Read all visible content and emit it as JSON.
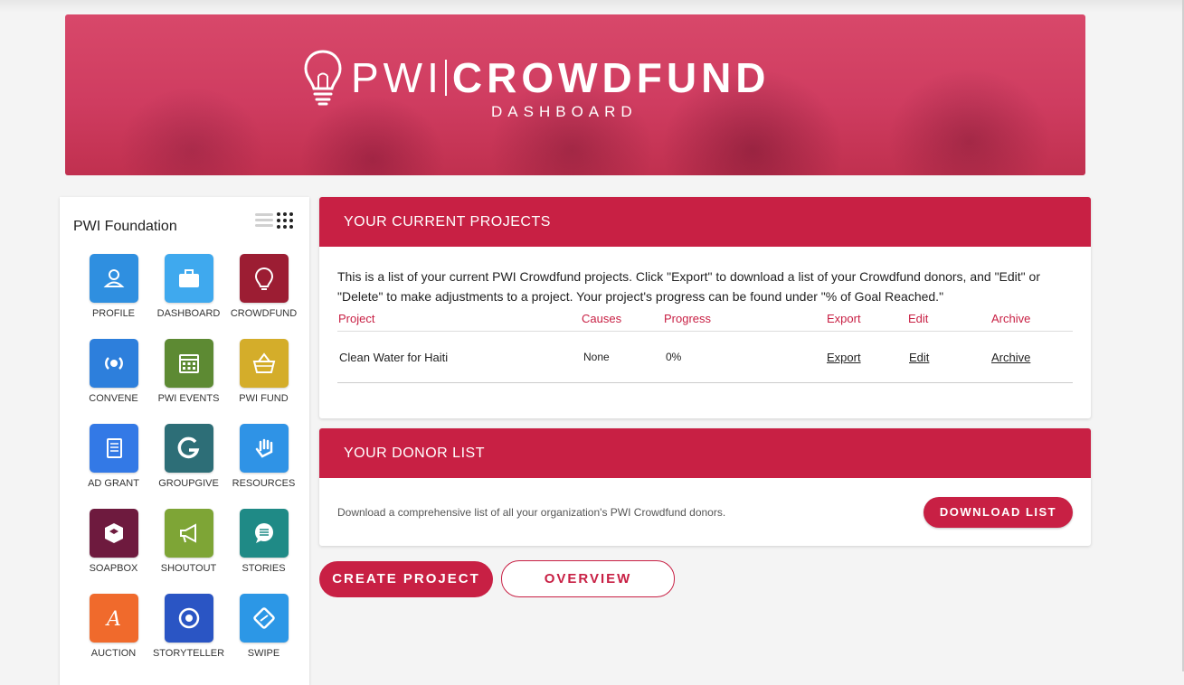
{
  "hero": {
    "brand_light": "PWI",
    "brand_bold": "CROWDFUND",
    "subtitle": "DASHBOARD"
  },
  "sidebar": {
    "org_name": "PWI Foundation",
    "apps": [
      {
        "label": "PROFILE",
        "icon": "profile-icon",
        "color": "#2f8fe0"
      },
      {
        "label": "DASHBOARD",
        "icon": "briefcase-icon",
        "color": "#3fa9ee"
      },
      {
        "label": "CROWDFUND",
        "icon": "lightbulb-icon",
        "color": "#9c1d33"
      },
      {
        "label": "CONVENE",
        "icon": "convene-icon",
        "color": "#2d7fdc"
      },
      {
        "label": "PWI EVENTS",
        "icon": "calendar-icon",
        "color": "#5d8a33"
      },
      {
        "label": "PWI FUND",
        "icon": "basket-icon",
        "color": "#d4ad2a"
      },
      {
        "label": "AD GRANT",
        "icon": "scroll-icon",
        "color": "#3379e6"
      },
      {
        "label": "GROUPGIVE",
        "icon": "groupgive-icon",
        "color": "#2d6e77"
      },
      {
        "label": "RESOURCES",
        "icon": "hand-icon",
        "color": "#2f93e6"
      },
      {
        "label": "SOAPBOX",
        "icon": "soapbox-icon",
        "color": "#6e1a3e"
      },
      {
        "label": "SHOUTOUT",
        "icon": "megaphone-icon",
        "color": "#7ea536"
      },
      {
        "label": "STORIES",
        "icon": "chat-icon",
        "color": "#1f8a86"
      },
      {
        "label": "AUCTION",
        "icon": "auction-icon",
        "color": "#f06a2c"
      },
      {
        "label": "STORYTELLER",
        "icon": "target-icon",
        "color": "#2a55c4"
      },
      {
        "label": "SWIPE",
        "icon": "swipe-icon",
        "color": "#2c97e6"
      }
    ]
  },
  "projects": {
    "title": "YOUR CURRENT PROJECTS",
    "intro": "This is a list of your current PWI Crowdfund projects. Click \"Export\" to download a list of your Crowdfund donors, and \"Edit\" or \"Delete\" to make adjustments to a project. Your project's progress can be found under \"% of Goal Reached.\"",
    "headers": {
      "project": "Project",
      "causes": "Causes",
      "progress": "Progress",
      "export": "Export",
      "edit": "Edit",
      "archive": "Archive"
    },
    "rows": [
      {
        "project": "Clean Water for Haiti",
        "causes": "None",
        "progress": "0%",
        "export": "Export",
        "edit": "Edit",
        "archive": "Archive"
      }
    ]
  },
  "donors": {
    "title": "YOUR DONOR LIST",
    "text": "Download a comprehensive list of all your organization's PWI Crowdfund donors.",
    "button": "DOWNLOAD LIST"
  },
  "actions": {
    "create": "CREATE PROJECT",
    "overview": "OVERVIEW"
  },
  "colors": {
    "accent": "#c82044"
  }
}
